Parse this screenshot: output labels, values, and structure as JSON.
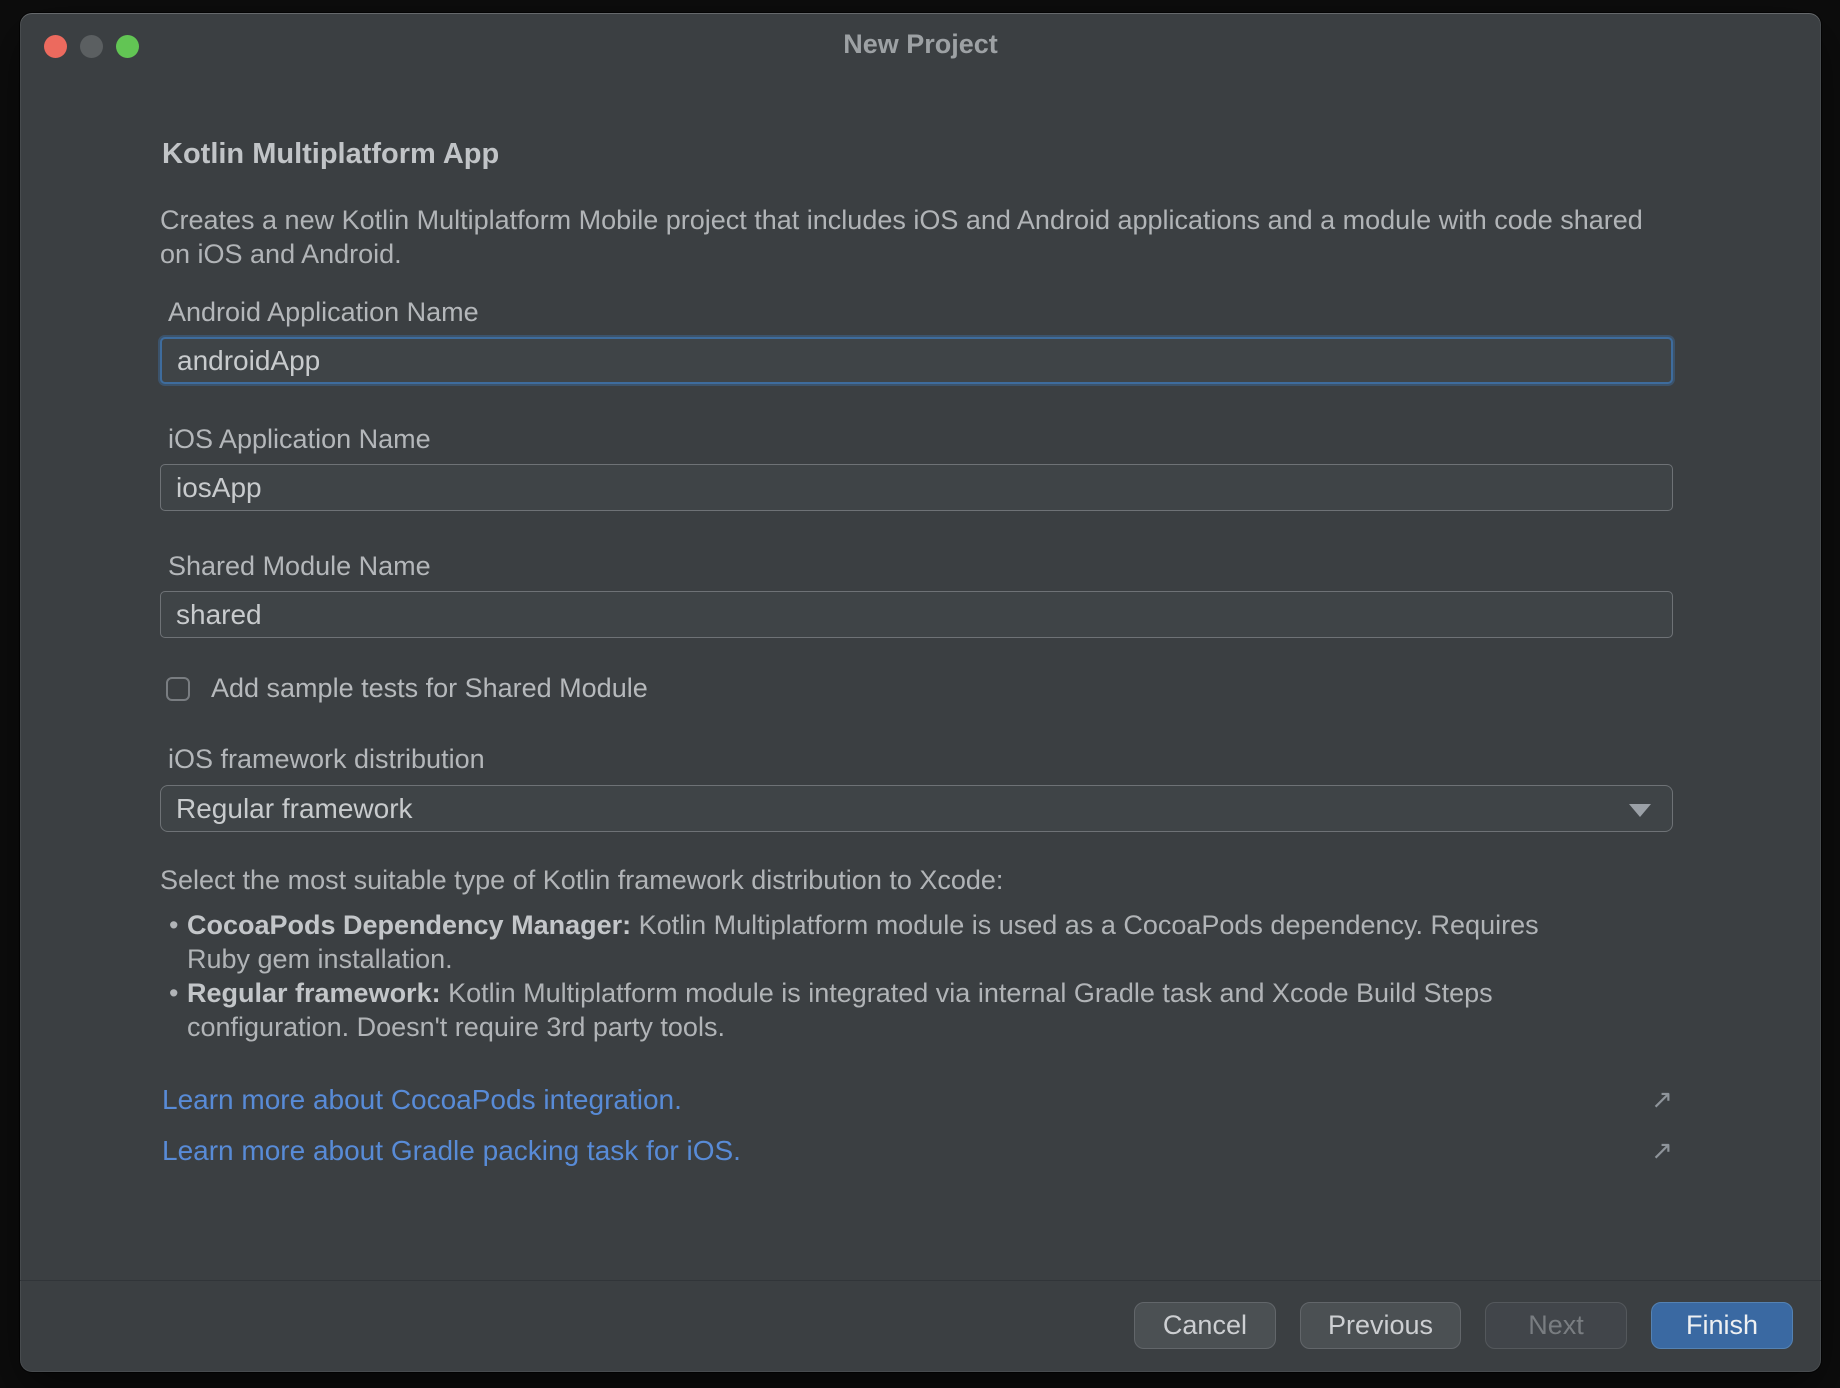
{
  "window": {
    "title": "New Project",
    "traffic_lights": {
      "close": "#ec6a5e",
      "minimize": "#5b5f61",
      "zoom": "#62c554"
    },
    "heading": "Kotlin Multiplatform App",
    "description": "Creates a new Kotlin Multiplatform Mobile project that includes iOS and Android applications and a module with code shared on iOS and Android.",
    "fields": [
      {
        "label": "Android Application Name",
        "value": "androidApp",
        "focused": true
      },
      {
        "label": "iOS Application Name",
        "value": "iosApp",
        "focused": false
      },
      {
        "label": "Shared Module Name",
        "value": "shared",
        "focused": false
      }
    ],
    "checkbox": {
      "label": "Add sample tests for Shared Module",
      "checked": false
    },
    "dropdown": {
      "label": "iOS framework distribution",
      "value": "Regular framework"
    },
    "framework_help": {
      "intro": "Select the most suitable type of Kotlin framework distribution to Xcode:",
      "bullets": [
        {
          "term": "CocoaPods Dependency Manager:",
          "text": " Kotlin Multiplatform module is used as a CocoaPods dependency. Requires Ruby gem installation."
        },
        {
          "term": "Regular framework:",
          "text": " Kotlin Multiplatform module is integrated via internal Gradle task and Xcode Build Steps configuration. Doesn't require 3rd party tools."
        }
      ]
    },
    "links": [
      {
        "text": "Learn more about CocoaPods integration.",
        "icon": "↗"
      },
      {
        "text": "Learn more about Gradle packing task for iOS.",
        "icon": "↗"
      }
    ],
    "footer": {
      "buttons": [
        {
          "label": "Cancel",
          "state": "normal"
        },
        {
          "label": "Previous",
          "state": "normal"
        },
        {
          "label": "Next",
          "state": "disabled"
        },
        {
          "label": "Finish",
          "state": "primary"
        }
      ]
    },
    "colors": {
      "window_bg": "#3b3f42",
      "input_bg": "#3f4447",
      "input_border": "#6e7276",
      "focus_border": "#3e6c9d",
      "link": "#588bd7",
      "primary_button": "#3a69a2",
      "text": "#b1b4b7"
    }
  }
}
